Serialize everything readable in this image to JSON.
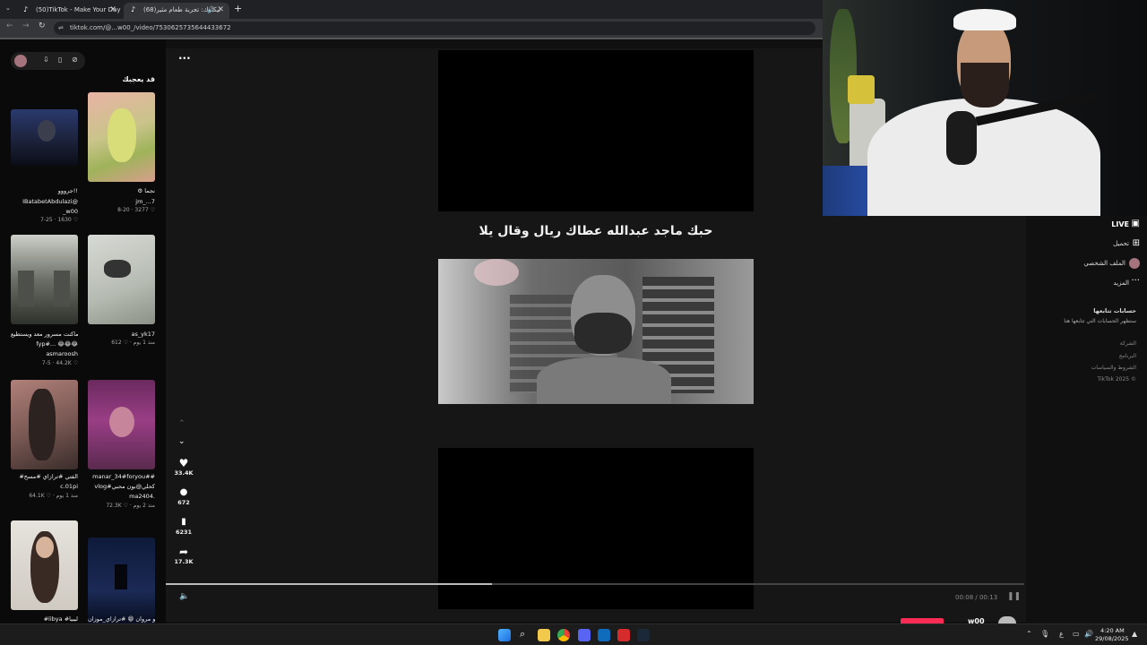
{
  "browser": {
    "tabs": [
      {
        "label": "(50)TikTok - Make Your Day",
        "active": false
      },
      {
        "label": "(68)تيكتوك: تجربة طعام مثير",
        "active": true
      }
    ],
    "url": "tiktok.com/@...w00_/video/7530625735644433672"
  },
  "left_panel": {
    "header": "قد يعجبك",
    "cards": [
      {
        "caption": "⚙ نجما",
        "author": "jm_...7",
        "meta": "8-20 · 3277 ♡"
      },
      {
        "caption": "جرووو!!",
        "author": "IBatabetAbdulazi@",
        "author2": "_w00",
        "meta": "7-25 · 1630 ♡"
      },
      {
        "caption": "as_yk17",
        "author": "",
        "meta": "612 ♡ · منذ 1 يوم"
      },
      {
        "caption": "أو ماكنت مسرور معد ويستطيع",
        "author": "fyp#... 😂😂😂",
        "author2": "asmaroosh",
        "meta": "7-5 · 44.2K ♡"
      },
      {
        "caption": "manar_34#foryou##",
        "author": "vlog#كحلي@بون محبي",
        "author2": "ma2404.",
        "meta": "72.3K ♡ · منذ 2 يوم"
      },
      {
        "caption": "#الفتي #ترازاي #مسح",
        "author": "c.01pi",
        "meta": "64.1K ♡ · منذ 1 يوم"
      },
      {
        "caption": "ابو مروان 😁 #ترازاي_موزان",
        "author": "",
        "meta": ""
      },
      {
        "caption": "#libya #ليبيا",
        "author": "",
        "meta": ""
      }
    ]
  },
  "video": {
    "caption": "حبك ماجد عبدالله عطاك ريال وقال يلا",
    "time": "00:08 / 00:13",
    "progress": 0.38,
    "actions": [
      {
        "name": "like",
        "icon": "♥",
        "count": "33.4K"
      },
      {
        "name": "comment",
        "icon": "💬",
        "count": "672"
      },
      {
        "name": "bookmark",
        "icon": "🔖",
        "count": "6231"
      },
      {
        "name": "share",
        "icon": "➦",
        "count": "17.3K"
      }
    ],
    "author_footer": "w00_"
  },
  "right_nav": {
    "live": "LIVE",
    "upload": "تحميل",
    "profile": "الملف الشخصي",
    "more": "المزيد",
    "following_title": "حسابات تتابعها",
    "following_sub": "ستظهر الحسابات التي تتابعها هنا",
    "links": [
      "الشركة",
      "البرنامج",
      "الشروط والسياسات",
      "TikTok 2025 ©"
    ]
  },
  "taskbar": {
    "time": "4:20 AM",
    "date": "29/08/2025"
  },
  "colors": {
    "tiktok_red": "#fe2c55",
    "bg": "#101010"
  }
}
